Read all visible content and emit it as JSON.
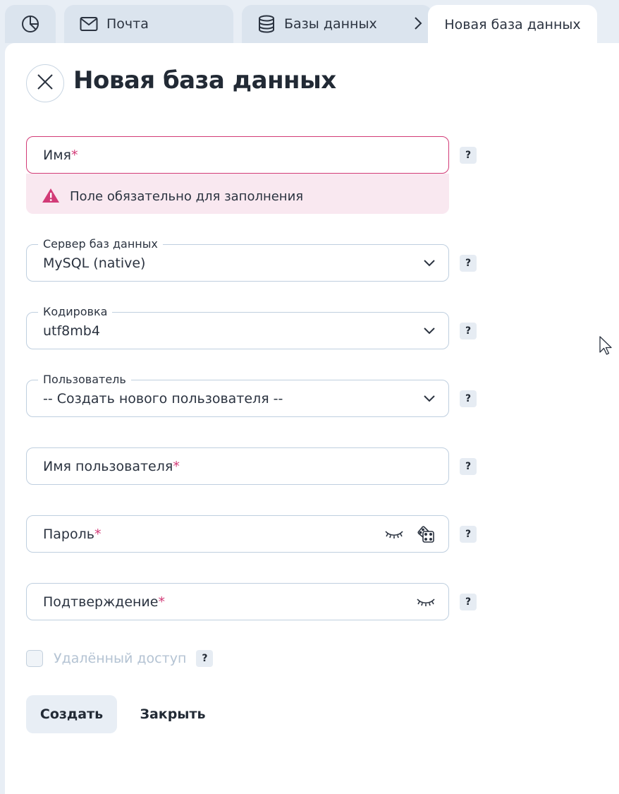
{
  "tabs": {
    "mail": "Почта",
    "databases": "Базы данных",
    "current": "Новая база данных"
  },
  "page": {
    "title": "Новая база данных"
  },
  "form": {
    "name": {
      "placeholder": "Имя",
      "required": "*",
      "error": "Поле обязательно для заполнения"
    },
    "server": {
      "label": "Сервер баз данных",
      "value": "MySQL (native)"
    },
    "encoding": {
      "label": "Кодировка",
      "value": "utf8mb4"
    },
    "user": {
      "label": "Пользователь",
      "value": "-- Создать нового пользователя --"
    },
    "username": {
      "placeholder": "Имя пользователя",
      "required": "*"
    },
    "password": {
      "placeholder": "Пароль",
      "required": "*"
    },
    "confirm": {
      "placeholder": "Подтверждение",
      "required": "*"
    },
    "remote_access": {
      "label": "Удалённый доступ",
      "checked": false
    },
    "help": "?"
  },
  "actions": {
    "create": "Создать",
    "close": "Закрыть"
  },
  "colors": {
    "error": "#d23b77",
    "error_bg": "#f9e8f0",
    "border": "#bfcfdf",
    "tab_bg": "#dbe4ee"
  }
}
